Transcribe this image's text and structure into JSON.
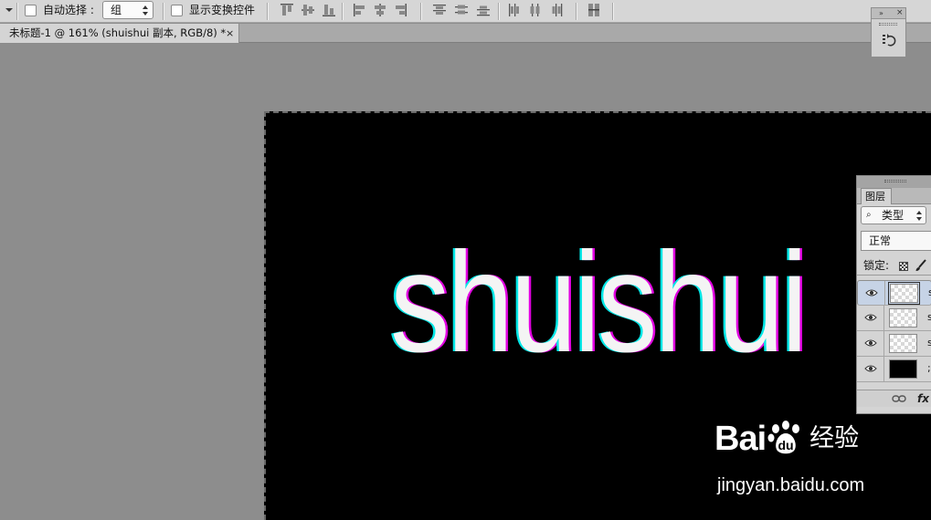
{
  "options_bar": {
    "auto_select_label": "自动选择 :",
    "auto_select_value": "组",
    "show_transform_label": "显示变换控件"
  },
  "document": {
    "tab_title": "未标题-1 @ 161% (shuishui 副本, RGB/8) *",
    "tab_close": "×"
  },
  "canvas": {
    "text": "shuishui"
  },
  "history_panel": {
    "collapse": "»",
    "close": "×",
    "icon": "history-icon"
  },
  "layers_panel": {
    "tab_label": "图层",
    "filter_value": "类型",
    "filter_icon": "search-icon",
    "blend_mode": "正常",
    "lock_label": "锁定:",
    "layers": [
      {
        "name": "s",
        "selected": true,
        "thumb": "transparent"
      },
      {
        "name": "s",
        "selected": false,
        "thumb": "transparent"
      },
      {
        "name": "s",
        "selected": false,
        "thumb": "transparent"
      },
      {
        "name": ";",
        "selected": false,
        "thumb": "black"
      }
    ],
    "footer_fx": "fx"
  },
  "watermark": {
    "logo_text_left": "Bai",
    "logo_text_right": "经验",
    "url": "jingyan.baidu.com"
  }
}
